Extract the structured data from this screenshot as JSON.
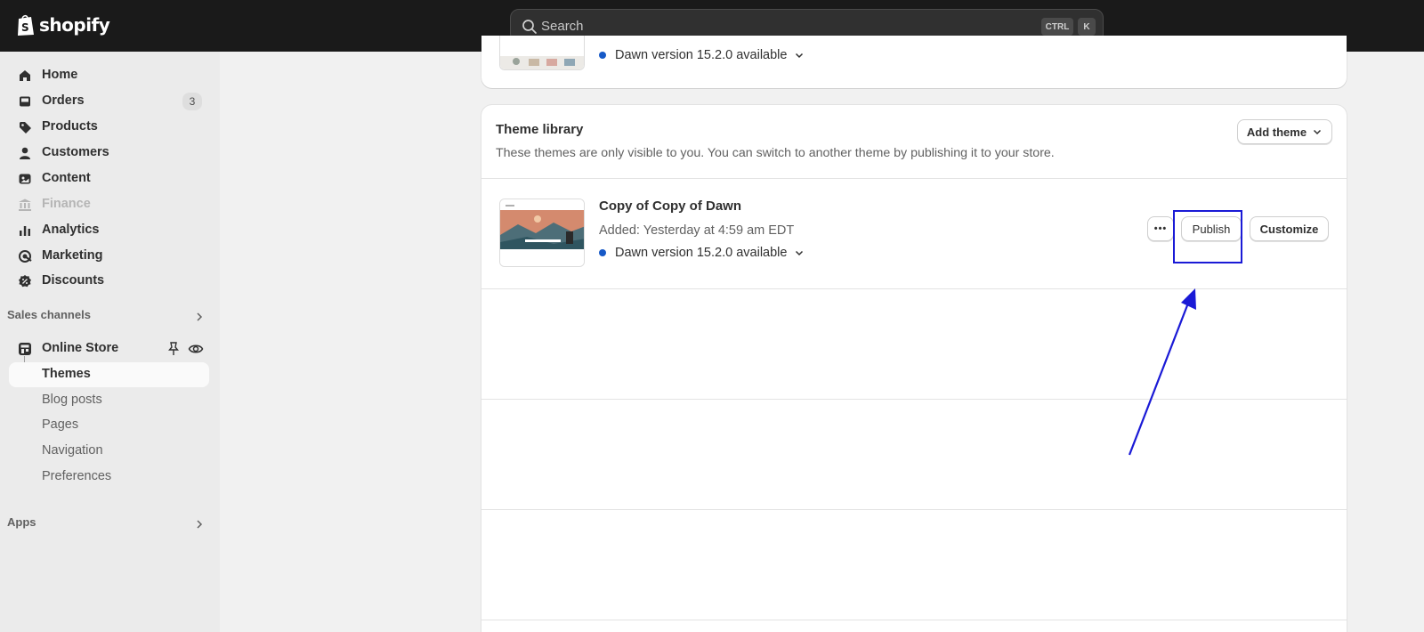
{
  "topbar": {
    "brand": "shopify",
    "search": {
      "placeholder": "Search",
      "shortcut_ctrl": "CTRL",
      "shortcut_key": "K"
    }
  },
  "sidebar": {
    "items": [
      {
        "label": "Home",
        "icon": "home-icon"
      },
      {
        "label": "Orders",
        "icon": "inbox-icon",
        "badge": "3"
      },
      {
        "label": "Products",
        "icon": "tag-icon"
      },
      {
        "label": "Customers",
        "icon": "person-icon"
      },
      {
        "label": "Content",
        "icon": "image-icon"
      },
      {
        "label": "Finance",
        "icon": "bank-icon",
        "disabled": true
      },
      {
        "label": "Analytics",
        "icon": "bar-chart-icon"
      },
      {
        "label": "Marketing",
        "icon": "target-icon"
      },
      {
        "label": "Discounts",
        "icon": "discount-icon"
      }
    ],
    "sales_channels_label": "Sales channels",
    "online_store": {
      "label": "Online Store",
      "subitems": [
        "Themes",
        "Blog posts",
        "Pages",
        "Navigation",
        "Preferences"
      ],
      "active": "Themes"
    },
    "apps_label": "Apps"
  },
  "current_theme": {
    "version_text": "Dawn version 15.2.0 available"
  },
  "theme_library": {
    "title": "Theme library",
    "description": "These themes are only visible to you. You can switch to another theme by publishing it to your store.",
    "add_theme_label": "Add theme",
    "themes": [
      {
        "name": "Copy of Copy of Dawn",
        "added": "Added: Yesterday at 4:59 am EDT",
        "version_text": "Dawn version 15.2.0 available",
        "more_label": "•••",
        "publish_label": "Publish",
        "customize_label": "Customize"
      }
    ]
  },
  "colors": {
    "topbar": "#1a1a1a",
    "sidebar": "#ebebeb",
    "version_dot": "#1659c7",
    "annotation": "#1a1ad6"
  }
}
